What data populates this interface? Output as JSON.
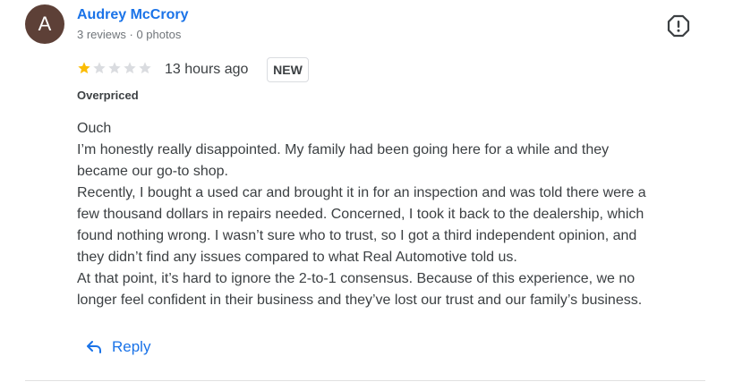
{
  "reviewer": {
    "initial": "A",
    "avatar_color": "#5d4037",
    "name": "Audrey McCrory",
    "meta": "3 reviews · 0 photos"
  },
  "flag": {
    "icon": "report-icon"
  },
  "rating": {
    "value": 1,
    "max": 5,
    "filled_color": "#fbbc04",
    "empty_color": "#dadce0"
  },
  "time_ago": "13 hours ago",
  "badge": "NEW",
  "tag": "Overpriced",
  "body": {
    "lines": [
      "Ouch",
      "I’m honestly really disappointed. My family had been going here for a while and they",
      "became our go-to shop.",
      "Recently, I bought a used car and brought it in for an inspection and was told there were a",
      "few thousand dollars in repairs needed. Concerned, I took it back to the dealership, which",
      "found nothing wrong. I wasn’t sure who to trust, so I got a third independent opinion, and",
      "they didn’t find any issues compared to what Real Automotive told us.",
      "At that point, it’s hard to ignore the 2-to-1 consensus. Because of this experience, we no",
      "longer feel confident in their business and they’ve lost our trust and our family’s business."
    ]
  },
  "reply": {
    "label": "Reply",
    "icon": "reply-arrow-icon",
    "color": "#1a73e8"
  }
}
